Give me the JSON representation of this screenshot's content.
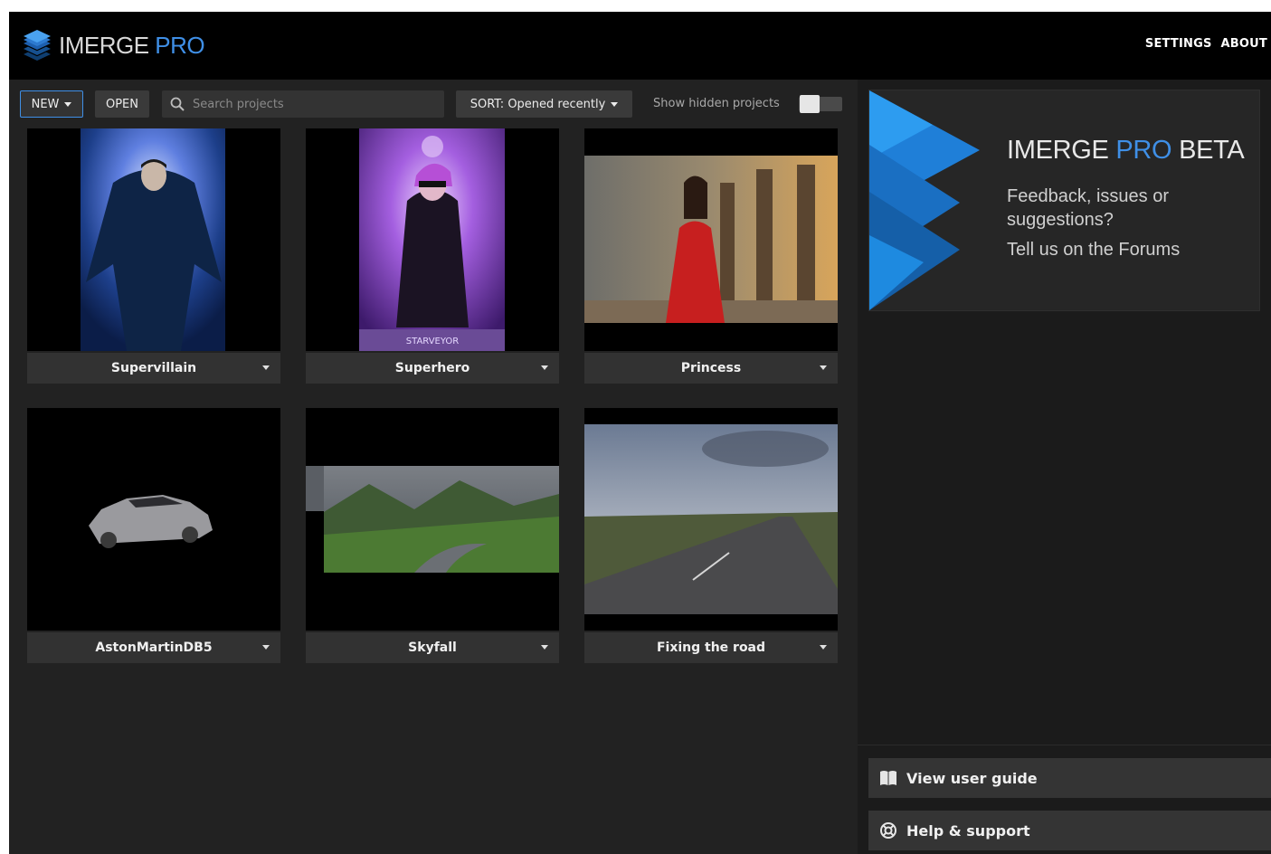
{
  "app": {
    "brand": "IMERGE",
    "brand_suffix": " PRO"
  },
  "topnav": {
    "settings": "SETTINGS",
    "about": "ABOUT"
  },
  "toolbar": {
    "new_label": "NEW",
    "open_label": "OPEN",
    "search_placeholder": "Search projects",
    "sort_label": "SORT: Opened recently",
    "show_hidden_label": "Show hidden projects",
    "show_hidden_on": false
  },
  "projects": [
    {
      "title": "Supervillain"
    },
    {
      "title": "Superhero",
      "poster_text": "STARVEYOR"
    },
    {
      "title": "Princess"
    },
    {
      "title": "AstonMartinDB5"
    },
    {
      "title": "Skyfall"
    },
    {
      "title": "Fixing the road"
    }
  ],
  "beta": {
    "title_a": "IMERGE ",
    "title_pro": "PRO",
    "title_b": " BETA",
    "text": "Feedback, issues or suggestions?",
    "link": "Tell us on the Forums"
  },
  "right_buttons": {
    "guide": "View user guide",
    "help": "Help & support"
  },
  "colors": {
    "accent": "#3f8fe6",
    "background": "#222222",
    "topbar": "#000000"
  },
  "icons": [
    "layers-logo-icon",
    "search-icon",
    "caret-down-icon",
    "book-icon",
    "lifebuoy-icon"
  ]
}
